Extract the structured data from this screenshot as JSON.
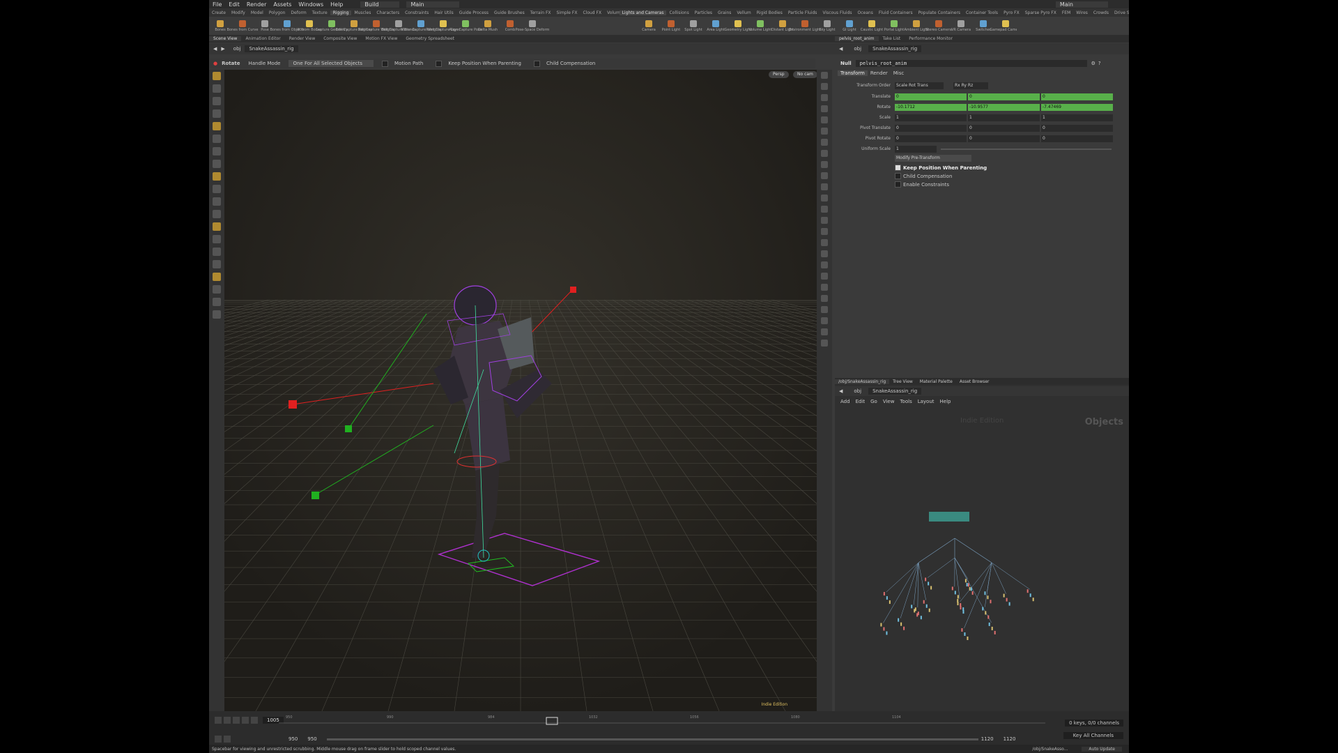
{
  "menubar": {
    "items": [
      "File",
      "Edit",
      "Render",
      "Assets",
      "Windows",
      "Help"
    ],
    "desktop": "Build",
    "main": "Main",
    "right": "Main"
  },
  "shelf_tabs_left": [
    "Create",
    "Modify",
    "Model",
    "Polygon",
    "Deform",
    "Texture",
    "Rigging",
    "Muscles",
    "Characters",
    "Constraints",
    "Hair Utils",
    "Guide Process",
    "Guide Brushes",
    "Terrain FX",
    "Simple FX",
    "Cloud FX",
    "Volume"
  ],
  "shelf_tabs_right": [
    "Lights and Cameras",
    "Collisions",
    "Particles",
    "Grains",
    "Vellum",
    "Rigid Bodies",
    "Particle Fluids",
    "Viscous Fluids",
    "Oceans",
    "Fluid Containers",
    "Populate Containers",
    "Container Tools",
    "Pyro FX",
    "Sparse Pyro FX",
    "FEM",
    "Wires",
    "Crowds",
    "Drive Simulation"
  ],
  "shelf_tools_left": [
    "Bones",
    "Bones from Curve",
    "Pose",
    "Bones from Objects",
    "IK from Bones",
    "Capture Geometry",
    "Edit Capture Regions",
    "Edit Capture Weights",
    "Edit Capture Blends",
    "Mirror Capture Weights",
    "Paint Capture Layer",
    "Align Capture Pose",
    "Delta Mush",
    "Comb",
    "Pose-Space Deform"
  ],
  "shelf_tools_right": [
    "Camera",
    "Point Light",
    "Spot Light",
    "Area Light",
    "Geometry Light",
    "Volume Light",
    "Distant Light",
    "Environment Light",
    "Sky Light",
    "GI Light",
    "Caustic Light",
    "Portal Light",
    "Ambient Light",
    "Stereo Camera",
    "VR Camera",
    "Switcher",
    "Gamepad Camera"
  ],
  "pane_tabs_left": [
    "Scene View",
    "Animation Editor",
    "Render View",
    "Composite View",
    "Motion FX View",
    "Geometry Spreadsheet"
  ],
  "pane_tabs_right": [
    "pelvis_root_anim",
    "Take List",
    "Performance Monitor"
  ],
  "viewport": {
    "path_context": "obj",
    "path_node": "SnakeAssassin_rig",
    "tool": "Rotate",
    "handle_mode": "Handle Mode",
    "selection_mode": "One For All Selected Objects",
    "options": [
      "Motion Path",
      "Keep Position When Parenting",
      "Child Compensation"
    ],
    "persp": "Persp",
    "cam": "No cam",
    "watermark": "Indie Edition"
  },
  "params": {
    "path_context": "obj",
    "path_node": "SnakeAssassin_rig",
    "node_type": "Null",
    "node_name": "pelvis_root_anim",
    "tabs": [
      "Transform",
      "Render",
      "Misc"
    ],
    "transform_order_label": "Transform Order",
    "transform_order": "Scale Rot Trans",
    "rotate_order": "Rx Ry Rz",
    "rows": [
      {
        "label": "Translate",
        "values": [
          "0",
          "0",
          "0"
        ],
        "color": "green"
      },
      {
        "label": "Rotate",
        "values": [
          "-10.1712",
          "-10.9577",
          "-7.47469"
        ],
        "color": "green"
      },
      {
        "label": "Scale",
        "values": [
          "1",
          "1",
          "1"
        ],
        "color": "grey"
      },
      {
        "label": "Pivot Translate",
        "values": [
          "0",
          "0",
          "0"
        ],
        "color": "grey"
      },
      {
        "label": "Pivot Rotate",
        "values": [
          "0",
          "0",
          "0"
        ],
        "color": "grey"
      }
    ],
    "uniform_scale_label": "Uniform Scale",
    "uniform_scale": "1",
    "modify_pre_transform": "Modify Pre-Transform",
    "checkbox_keep": "Keep Position When Parenting",
    "checkbox_child": "Child Compensation",
    "checkbox_constraints": "Enable Constraints"
  },
  "network": {
    "tabs": [
      "/obj/SnakeAssassin_rig",
      "Tree View",
      "Material Palette",
      "Asset Browser"
    ],
    "path_context": "obj",
    "path_node": "SnakeAssassin_rig",
    "menu": [
      "Add",
      "Edit",
      "Go",
      "View",
      "Tools",
      "Layout",
      "Help"
    ],
    "watermark": "Indie Edition",
    "context_label": "Objects"
  },
  "timeline": {
    "current_frame": "1005",
    "start": "950",
    "start2": "950",
    "end": "1120",
    "end2": "1120",
    "ticks": [
      "950",
      "990",
      "984",
      "1032",
      "1056",
      "1080",
      "1104"
    ],
    "keys_info": "0 keys, 0/0 channels",
    "key_all": "Key All Channels",
    "status_path": "/obj/SnakeAsso...",
    "auto_update": "Auto Update",
    "status_text": "Spacebar for viewing and unrestricted scrubbing. Middle mouse drag on frame slider to hold scoped channel values."
  },
  "colors": {
    "accent_green": "#58b04a",
    "handle_red": "#e02020",
    "handle_green": "#20b020",
    "rig_purple": "#a040e0"
  }
}
